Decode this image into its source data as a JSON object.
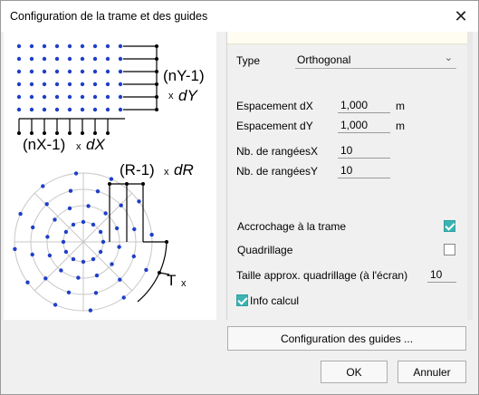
{
  "window": {
    "title": "Configuration de la trame et des guides"
  },
  "illustration": {
    "rows_label": "(nY-1)",
    "rows_mult": "x",
    "rows_var": "dY",
    "cols_label": "(nX-1)",
    "cols_mult": "x",
    "cols_var": "dX",
    "radial_label": "(R-1)",
    "radial_mult": "x",
    "radial_var": "dR",
    "angle_label": "T",
    "angle_mult": "x"
  },
  "form": {
    "type_label": "Type",
    "type_value": "Orthogonal",
    "dx_label": "Espacement dX",
    "dx_value": "1,000",
    "dx_unit": "m",
    "dy_label": "Espacement dY",
    "dy_value": "1,000",
    "dy_unit": "m",
    "nx_label": "Nb. de rangéesX",
    "nx_value": "10",
    "ny_label": "Nb. de rangéesY",
    "ny_value": "10",
    "snap_label": "Accrochage à la trame",
    "snap_checked": true,
    "grid_label": "Quadrillage",
    "grid_checked": false,
    "gridsize_label": "Taille approx. quadrillage (à l'écran)",
    "gridsize_value": "10",
    "info_label": "Info calcul",
    "info_checked": true
  },
  "buttons": {
    "guides": "Configuration des guides ...",
    "ok": "OK",
    "cancel": "Annuler"
  },
  "colors": {
    "accent": "#3cb3b3",
    "dots": "#1f3fc8"
  }
}
